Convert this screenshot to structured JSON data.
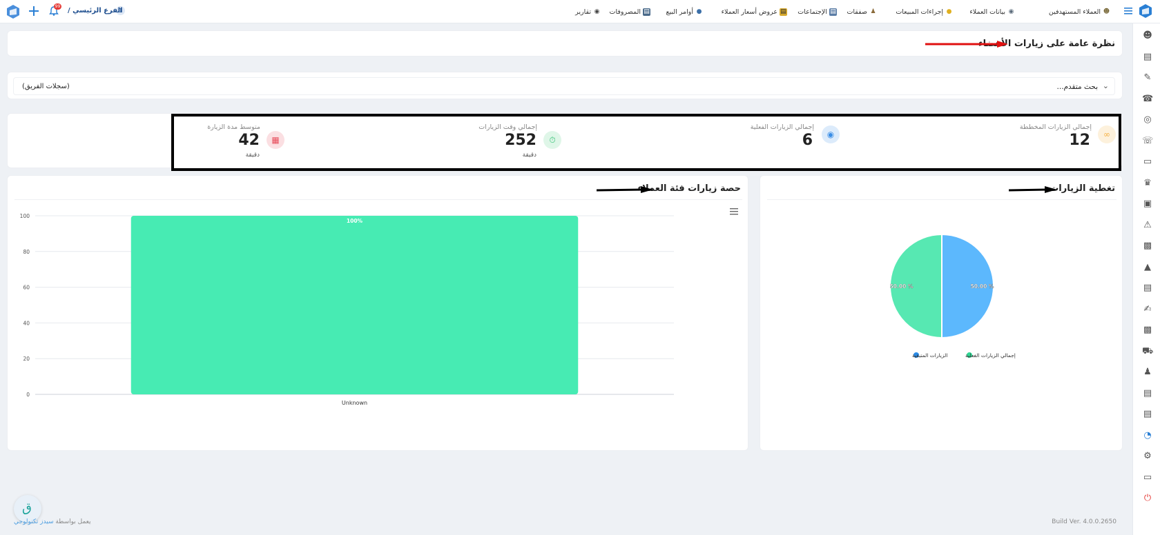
{
  "topbar": {
    "nav": [
      {
        "label": "العملاء المستهدفين",
        "icon": "people-group-icon"
      },
      {
        "label": "بيانات العملاء",
        "icon": "customer-data-icon"
      },
      {
        "label": "إجراءات المبيعات",
        "icon": "lightbulb-icon"
      },
      {
        "label": "صفقات",
        "icon": "deals-icon"
      },
      {
        "label": "الإجتماعات",
        "icon": "presentation-board-icon"
      },
      {
        "label": "عروض أسعار العملاء",
        "icon": "quotation-icon"
      },
      {
        "label": "أوامر البيع",
        "icon": "money-bag-icon"
      },
      {
        "label": "المصروفات",
        "icon": "expenses-icon"
      },
      {
        "label": "تقارير",
        "icon": "reports-icon"
      }
    ],
    "branch_label": "الفرع الرئيسي /",
    "branch_badge": "1",
    "notification_count": "99"
  },
  "page": {
    "title": "نظرة عامة على زيارات الأعضاء",
    "advanced_search": "بحث متقدم...",
    "team_records": "(سجلات الفريق)"
  },
  "stats": [
    {
      "label": "إجمالي الزيارات المخططة",
      "value": "12",
      "unit": "",
      "icon": "link-icon",
      "color": "#f5b042",
      "bg": "#fdf1dc"
    },
    {
      "label": "إجمالي الزيارات الفعلية",
      "value": "6",
      "unit": "",
      "icon": "eye-icon",
      "color": "#3a8ee6",
      "bg": "#dcebfb"
    },
    {
      "label": "إجمالي وقت الزيارات",
      "value": "252",
      "unit": "دقيقة",
      "icon": "stopwatch-icon",
      "color": "#2fbf71",
      "bg": "#dff6e8"
    },
    {
      "label": "متوسط مدة الزيارة",
      "value": "42",
      "unit": "دقيقة",
      "icon": "calendar-icon",
      "color": "#e74c5b",
      "bg": "#fbdfe2"
    }
  ],
  "coverage": {
    "title": "تغطية الزيارات",
    "chart_data": {
      "type": "pie",
      "slices": [
        {
          "name": "الزيارات المتبقية",
          "value": 50.0,
          "label": "50.00 %",
          "color": "#5cb8fd"
        },
        {
          "name": "إجمالي الزيارات الفعلية",
          "value": 50.0,
          "label": "50.00 %",
          "color": "#57e8b2"
        }
      ],
      "legend": [
        "إجمالي الزيارات الفعلية",
        "الزيارات المتبقية"
      ],
      "legend_colors": [
        "#2fd995",
        "#2a8be6"
      ]
    }
  },
  "share": {
    "title": "حصة زيارات فئة العملاء",
    "menu_icon": "hamburger-menu-icon",
    "chart_data": {
      "type": "bar",
      "categories": [
        "Unknown"
      ],
      "values": [
        100
      ],
      "data_labels": [
        "100%"
      ],
      "ylim": [
        0,
        100
      ],
      "yticks": [
        "0",
        "20",
        "40",
        "60",
        "80",
        "100"
      ],
      "color": "#47ebb3"
    }
  },
  "footer": {
    "powered_by": "يعمل بواسطة",
    "company": "سيدز تكنولوجي",
    "build": "Build Ver. 4.0.0.2650"
  },
  "sidebar_icons": [
    "users-icon",
    "document-icon",
    "contract-icon",
    "phone-icon",
    "target-icon",
    "telephone-icon",
    "card-icon",
    "team-icon",
    "cash-icon",
    "warning-icon",
    "device-icon",
    "road-icon",
    "invoice-icon",
    "signature-icon",
    "printer-icon",
    "truck-icon",
    "user-transfer-icon",
    "receipt-icon",
    "report-icon",
    "chart-icon",
    "settings-icon",
    "window-icon",
    "power-icon"
  ]
}
